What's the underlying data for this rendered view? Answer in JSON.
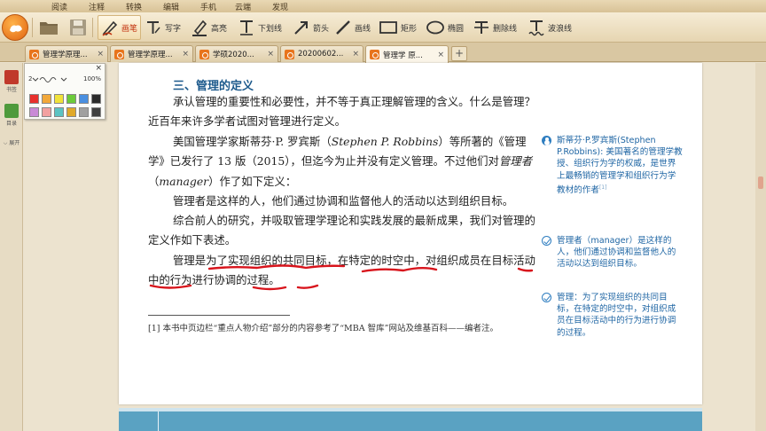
{
  "menu": [
    "阅读",
    "注释",
    "转换",
    "编辑",
    "手机",
    "云端",
    "发现"
  ],
  "toolbar": {
    "tools": [
      {
        "label": "画笔",
        "icon": "pen-icon"
      },
      {
        "label": "写字",
        "icon": "text-tool-icon"
      },
      {
        "label": "高亮",
        "icon": "highlight-icon"
      },
      {
        "label": "下划线",
        "icon": "underline-icon"
      },
      {
        "label": "箭头",
        "icon": "arrow-icon"
      },
      {
        "label": "画线",
        "icon": "line-icon"
      },
      {
        "label": "矩形",
        "icon": "rectangle-icon"
      },
      {
        "label": "椭圆",
        "icon": "ellipse-icon"
      },
      {
        "label": "删除线",
        "icon": "strikethrough-icon"
      },
      {
        "label": "波浪线",
        "icon": "wavy-line-icon"
      }
    ],
    "active_tool": "画笔"
  },
  "tabs": [
    {
      "label": "管理学原理..."
    },
    {
      "label": "管理学原理..."
    },
    {
      "label": "学硕2020..."
    },
    {
      "label": "20200602..."
    },
    {
      "label": "管理学 原..."
    }
  ],
  "new_tab": "+",
  "sidebar": {
    "bookmark_label": "书签",
    "toc_label": "目录",
    "expand_label": "展开"
  },
  "palette": {
    "close": "×",
    "size": "2",
    "zoom": "100%",
    "colors": [
      "#e8302c",
      "#f2a83a",
      "#f1e23a",
      "#6bcb3a",
      "#4a8fe0",
      "#2b2b2b",
      "#c98ad6",
      "#f2a0a0",
      "#5cc3c3",
      "#e0a92a",
      "#a0a0a0",
      "#404040"
    ]
  },
  "document": {
    "heading": "三、管理的定义",
    "p1": "承认管理的重要性和必要性，并不等于真正理解管理的含义。什么是管理？近百年来许多学者试图对管理进行定义。",
    "p2a": "美国管理学家斯蒂芬·P. 罗宾斯（",
    "p2b": "Stephen P. Robbins",
    "p2c": "）等所著的《管理学》已发行了 13 版（2015），但迄今为止并没有定义管理。不过他们对",
    "p2d": "管理者",
    "p2e": "（",
    "p2f": "manager",
    "p2g": "）作了如下定义：",
    "p3": "管理者是这样的人，他们通过协调和监督他人的活动以达到组织目标。",
    "p4": "综合前人的研究，并吸取管理学理论和实践发展的最新成果，我们对管理的定义作如下表述。",
    "p5": "管理是为了实现组织的共同目标，在特定的时空中，对组织成员在目标活动中的行为进行协调的过程。",
    "footnote": "[1]  本书中页边栏“重点人物介绍”部分的内容参考了“MBA 智库”网站及维基百科——编者注。"
  },
  "side_notes": [
    {
      "icon": "person-icon",
      "text": "斯蒂芬·P.罗宾斯(Stephen P.Robbins): 美国著名的管理学教授、组织行为学的权威，是世界上最畅销的管理学和组织行为学教材的作者",
      "sup": "[1]"
    },
    {
      "icon": "check-circle-icon",
      "text": "管理者（manager）是这样的人，他们通过协调和监督他人的活动以达到组织目标。",
      "sup": ""
    },
    {
      "icon": "check-circle-icon",
      "text": "管理：为了实现组织的共同目标，在特定的时空中，对组织成员在目标活动中的行为进行协调的过程。",
      "sup": ""
    }
  ],
  "colors": {
    "accent": "#e06a14",
    "note_blue": "#1f66a4",
    "heading_blue": "#1d5a8c",
    "ink_red": "#d8141c"
  }
}
